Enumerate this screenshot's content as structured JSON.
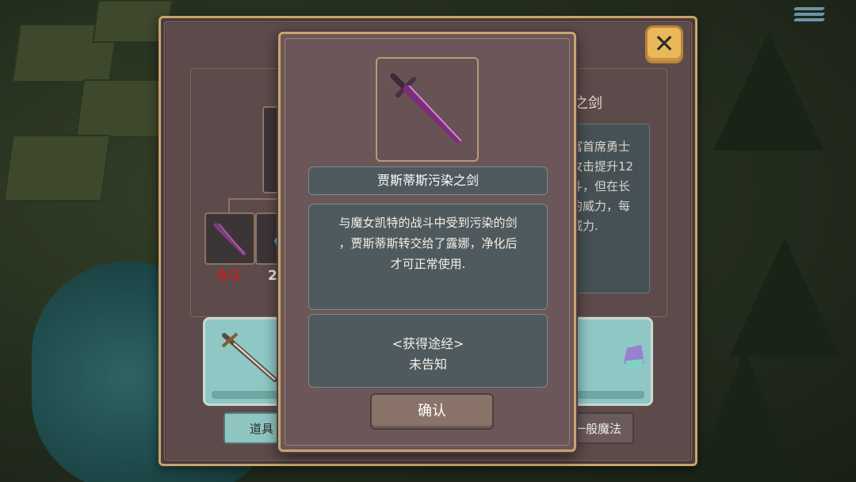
{
  "background_panel": {
    "title": "",
    "item_title_partial": "之剑",
    "description_partial": "富首席勇士\n攻击提升12\n斗，但在长\n的威力，每\n威力.",
    "material_counts": [
      {
        "text": "0/1",
        "color": "#c0241c"
      },
      {
        "text": "2/",
        "color": "#ececec"
      }
    ],
    "tabs": {
      "left": "道具",
      "right": "一般魔法"
    },
    "close_symbol": "✕"
  },
  "dialog": {
    "item_name": "贾斯蒂斯污染之剑",
    "description_lines": [
      "与魔女凯特的战斗中受到污染的剑",
      "，贾斯蒂斯转交给了露娜，净化后",
      "才可正常使用."
    ],
    "source_heading": "<获得途经>",
    "source_value": "未告知",
    "confirm_label": "确认"
  },
  "colors": {
    "frame_gold": "#c9a46f",
    "panel_mauve": "#6b5759",
    "box_slate": "#4f5a5e",
    "accent_teal": "#8fc7c4",
    "close_button": "#e8b85a",
    "sword_purple": "#7a2f78"
  },
  "icons": [
    "sword-icon",
    "crystal-icon",
    "potion-icon",
    "close-icon",
    "menu-icon"
  ]
}
